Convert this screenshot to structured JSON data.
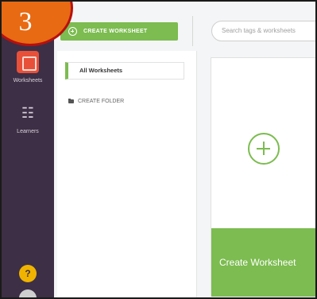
{
  "badge": {
    "number": "3"
  },
  "toolbar": {
    "create_worksheet_label": "CREATE WORKSHEET",
    "search_placeholder": "Search tags & worksheets"
  },
  "sidebar": {
    "items": [
      {
        "label": "Worksheets",
        "icon": "worksheets-icon",
        "active": true
      },
      {
        "label": "Learners",
        "icon": "learners-icon",
        "active": false
      }
    ],
    "help_label": "?"
  },
  "folders": {
    "all_worksheets_label": "All Worksheets",
    "create_folder_label": "CREATE FOLDER"
  },
  "card": {
    "footer_label": "Create Worksheet"
  },
  "colors": {
    "accent": "#7cbc50",
    "sidebar": "#3d2f45",
    "active_nav": "#e8503a",
    "help": "#f0b400"
  }
}
